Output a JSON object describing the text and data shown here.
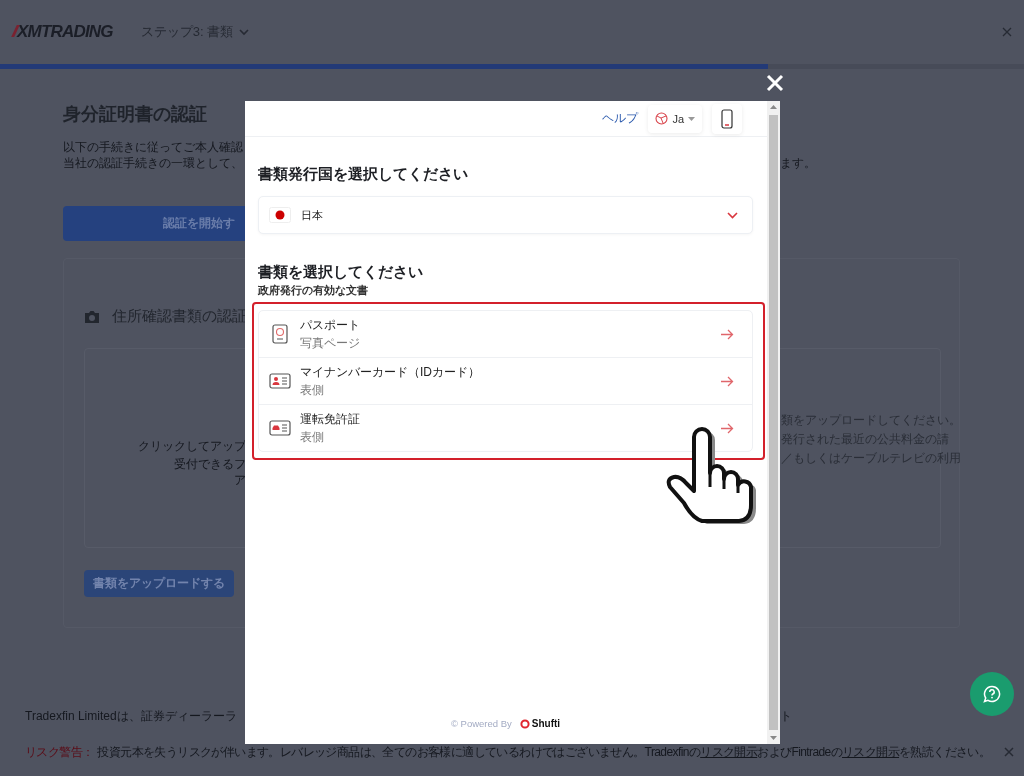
{
  "header": {
    "logo": "XMTRADING",
    "step_menu": "ステップ3: 書類"
  },
  "progress": {
    "level": 0.75
  },
  "page": {
    "title": "身分証明書の認証",
    "intro_lines": [
      "以下の手続きに従ってご本人確認",
      "当社の認証手続きの一環として、"
    ],
    "intro_tail": "ます。",
    "start_button": "認証を開始す",
    "address_section": {
      "title": "住所確認書類の認証",
      "dropzone_lines": [
        "クリックしてアップ",
        "受付できるフ",
        "ア"
      ],
      "instructions": [
        "類をアップロードしてください。",
        "発行された最近の公共料金の請",
        "／もしくはケーブルテレビの利用"
      ],
      "upload_button": "書類をアップロードする"
    }
  },
  "footer": {
    "company_text": "Tradexfin Limitedは、証券ディーラーラ",
    "company_tail": "ト",
    "risk_label": "リスク警告：",
    "risk_parts": [
      {
        "text": "投資元本を失うリスクが伴います。レバレッジ商品は、全てのお客様に適しているわけではございません。Tradexfinの",
        "link": false
      },
      {
        "text": "リスク開示",
        "link": true
      },
      {
        "text": "およびFintradeの",
        "link": false
      },
      {
        "text": "リスク開示",
        "link": true
      },
      {
        "text": "を熟読ください。",
        "link": false
      }
    ]
  },
  "modal": {
    "help": "ヘルプ",
    "language": "Ja",
    "country_heading": "書類発行国を選択してください",
    "country": "日本",
    "document_heading": "書類を選択してください",
    "document_subheading": "政府発行の有効な文書",
    "documents": [
      {
        "kind": "passport",
        "title": "パスポート",
        "subtitle": "写真ページ"
      },
      {
        "kind": "id-card",
        "title": "マイナンバーカード（IDカード）",
        "subtitle": "表側"
      },
      {
        "kind": "license",
        "title": "運転免許証",
        "subtitle": "表側"
      }
    ],
    "powered_by": "© Powered By",
    "brand": "Shufti"
  }
}
